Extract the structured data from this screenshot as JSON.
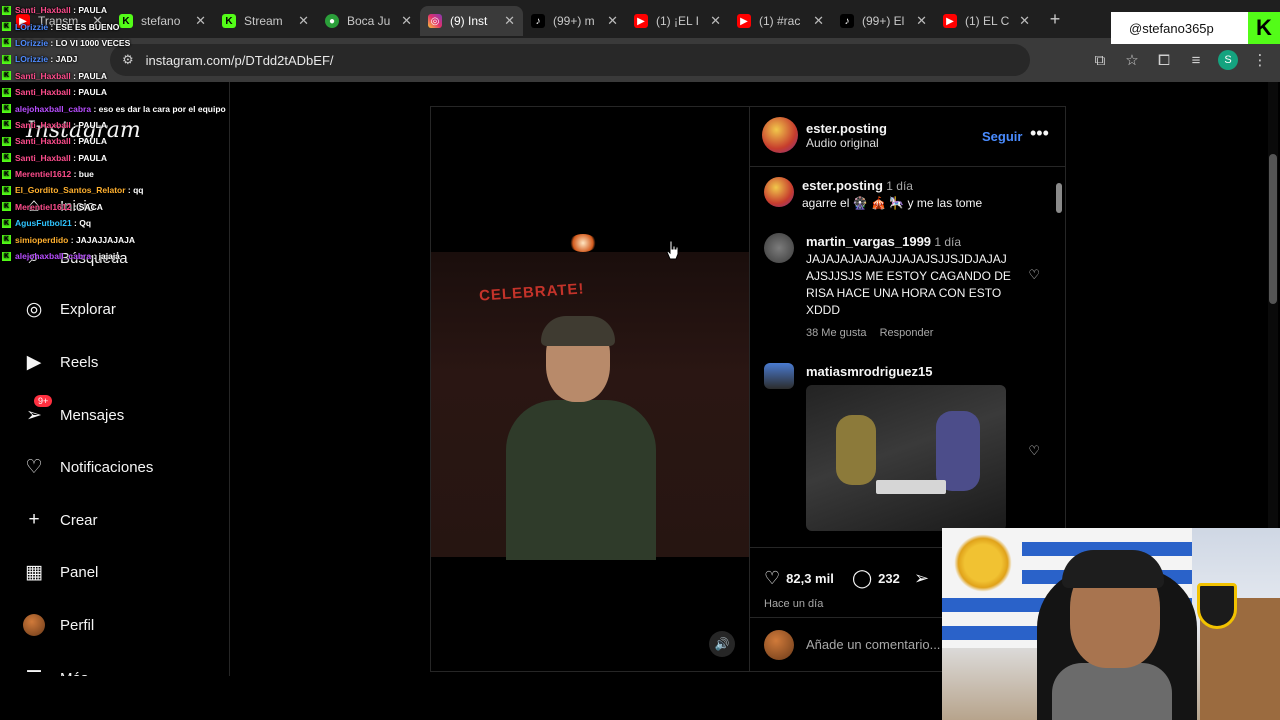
{
  "browser": {
    "tabs": [
      {
        "label": "Transm",
        "icon": "youtube-icon",
        "active": false
      },
      {
        "label": "stefano",
        "icon": "kick-icon",
        "active": false
      },
      {
        "label": "Stream",
        "icon": "kick-icon",
        "active": false
      },
      {
        "label": "Boca Ju",
        "icon": "boca-icon",
        "active": false
      },
      {
        "label": "(9) Inst",
        "icon": "instagram-icon",
        "active": true
      },
      {
        "label": "(99+) m",
        "icon": "tiktok-icon",
        "active": false
      },
      {
        "label": "(1) ¡EL I",
        "icon": "youtube-icon",
        "active": false
      },
      {
        "label": "(1) #rac",
        "icon": "youtube-icon",
        "active": false
      },
      {
        "label": "(99+) El",
        "icon": "tiktok-icon",
        "active": false
      },
      {
        "label": "(1) EL C",
        "icon": "youtube-icon",
        "active": false
      }
    ],
    "url": "instagram.com/p/DTdd2tADbEF/",
    "profile_initial": "S"
  },
  "stream_overlay": {
    "kick_handle": "@stefano365p",
    "kick_logo": "K",
    "chat": [
      {
        "user": "Santi_Haxball",
        "msg": "PAULA",
        "color": "#ff4d8d"
      },
      {
        "user": "LOrizzie",
        "msg": "ESE ES BUENO",
        "color": "#4f8cff"
      },
      {
        "user": "LOrizzie",
        "msg": "LO VI 1000 VECES",
        "color": "#4f8cff"
      },
      {
        "user": "LOrizzie",
        "msg": "JADJ",
        "color": "#4f8cff"
      },
      {
        "user": "Santi_Haxball",
        "msg": "PAULA",
        "color": "#ff4d8d"
      },
      {
        "user": "Santi_Haxball",
        "msg": "PAULA",
        "color": "#ff4d8d"
      },
      {
        "user": "alejohaxball_cabra",
        "msg": "eso es dar la cara por el equipo",
        "color": "#b84dff"
      },
      {
        "user": "Santi_Haxball",
        "msg": "PAULA",
        "color": "#ff4d8d"
      },
      {
        "user": "Santi_Haxball",
        "msg": "PAULA",
        "color": "#ff4d8d"
      },
      {
        "user": "Santi_Haxball",
        "msg": "PAULA",
        "color": "#ff4d8d"
      },
      {
        "user": "Merentiel1612",
        "msg": "bue",
        "color": "#ff4d8d"
      },
      {
        "user": "El_Gordito_Santos_Relator",
        "msg": "qq",
        "color": "#ffb02e"
      },
      {
        "user": "Merentiel1612",
        "msg": "SACA",
        "color": "#ff4d8d"
      },
      {
        "user": "AgusFutbol21",
        "msg": "Qq",
        "color": "#2ec4ff"
      },
      {
        "user": "simioperdido",
        "msg": "JAJAJJAJAJA",
        "color": "#ffb02e"
      },
      {
        "user": "alejohaxball_cabra",
        "msg": "jajaja",
        "color": "#b84dff"
      }
    ]
  },
  "sidebar": {
    "logo": "Instagram",
    "items": [
      {
        "label": "Inicio",
        "icon": "home-icon"
      },
      {
        "label": "Búsqueda",
        "icon": "search-icon"
      },
      {
        "label": "Explorar",
        "icon": "compass-icon"
      },
      {
        "label": "Reels",
        "icon": "reels-icon"
      },
      {
        "label": "Mensajes",
        "icon": "messages-icon",
        "badge": "9+"
      },
      {
        "label": "Notificaciones",
        "icon": "heart-icon"
      },
      {
        "label": "Crear",
        "icon": "plus-icon"
      },
      {
        "label": "Panel",
        "icon": "dashboard-icon"
      },
      {
        "label": "Perfil",
        "icon": "profile-avatar"
      },
      {
        "label": "Más",
        "icon": "menu-icon"
      }
    ]
  },
  "post": {
    "author": "ester.posting",
    "audio": "Audio original",
    "follow_label": "Seguir",
    "video_text": "CELEBRATE!",
    "comments": [
      {
        "user": "ester.posting",
        "time": "1 día",
        "text": "agarre el 🎡 🎪 🎠 y me las tome"
      },
      {
        "user": "martin_vargas_1999",
        "time": "1 día",
        "text": "JAJAJAJAJAJAJJAJAJSJJSJDJAJAJ AJSJJSJS ME ESTOY CAGANDO DE RISA HACE UNA HORA CON ESTO XDDD",
        "likes": "38 Me gusta",
        "reply": "Responder"
      },
      {
        "user": "matiasmrodriguez15",
        "time": "",
        "text": ""
      }
    ],
    "likes": "82,3 mil",
    "comments_count": "232",
    "posted": "Hace un día",
    "add_comment_placeholder": "Añade un comentario..."
  }
}
